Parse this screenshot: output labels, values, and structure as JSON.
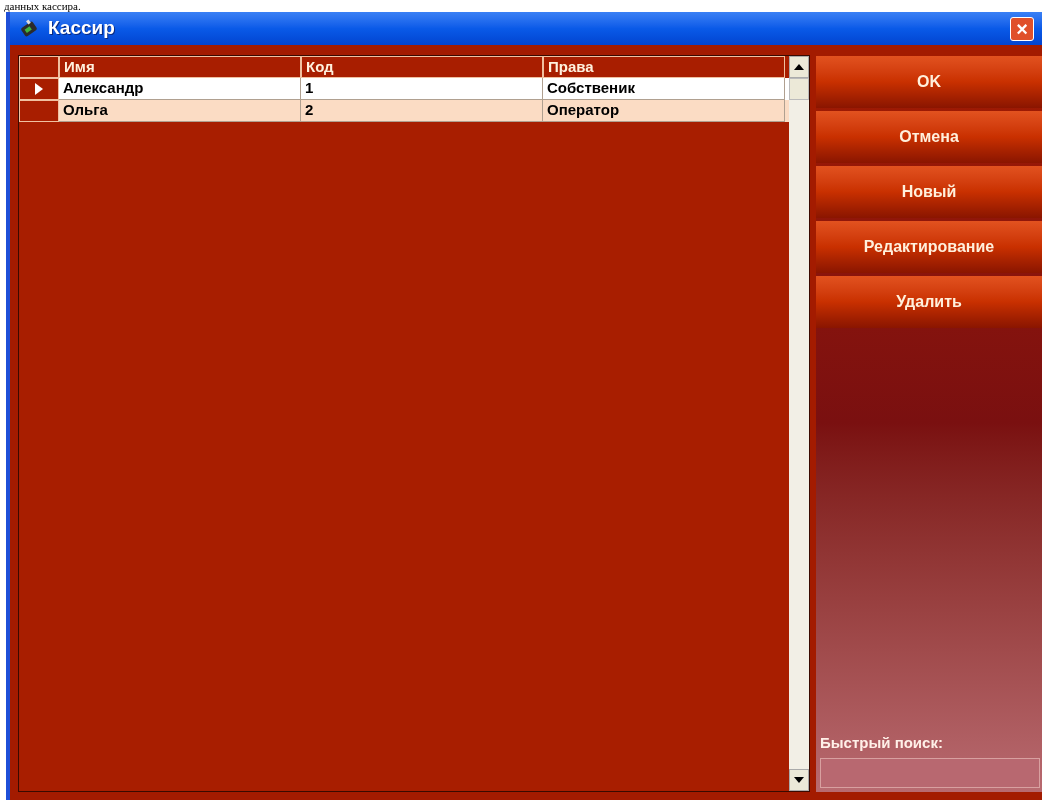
{
  "caption": "данных кассира.",
  "window": {
    "title": "Кассир",
    "close": "×"
  },
  "table": {
    "columns": [
      "Имя",
      "Код",
      "Права"
    ],
    "rows": [
      {
        "cells": [
          "Александр",
          "1",
          "Собственик"
        ],
        "selected": true
      },
      {
        "cells": [
          "Ольга",
          "2",
          "Оператор"
        ],
        "selected": false
      }
    ]
  },
  "buttons": [
    "OK",
    "Отмена",
    "Новый",
    "Редактирование",
    "Удалить"
  ],
  "search": {
    "label": "Быстрый поиск:"
  }
}
